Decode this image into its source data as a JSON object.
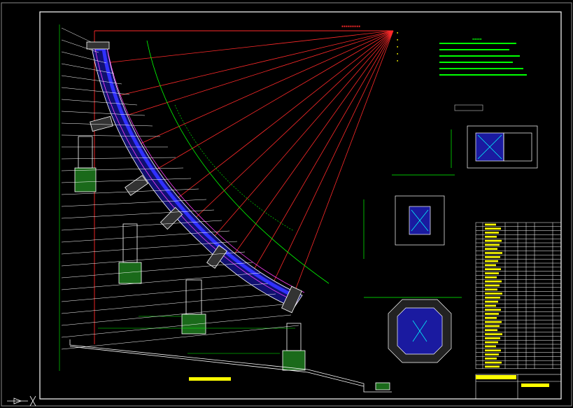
{
  "drawing": {
    "title_red": "",
    "title_block_caption": "",
    "notes_heading": "",
    "notes_lines": [],
    "views": []
  },
  "colors": {
    "background": "#000000",
    "frame": "#ffffff",
    "ray": "#ff2a2a",
    "blue_fill": "#1a1aa0",
    "magenta": "#ff40ff",
    "cyan": "#00ffff",
    "green": "#00ff00",
    "yellow": "#ffff00",
    "pier": "#22aa22"
  },
  "ucs_icon": "ucs-axis-icon"
}
